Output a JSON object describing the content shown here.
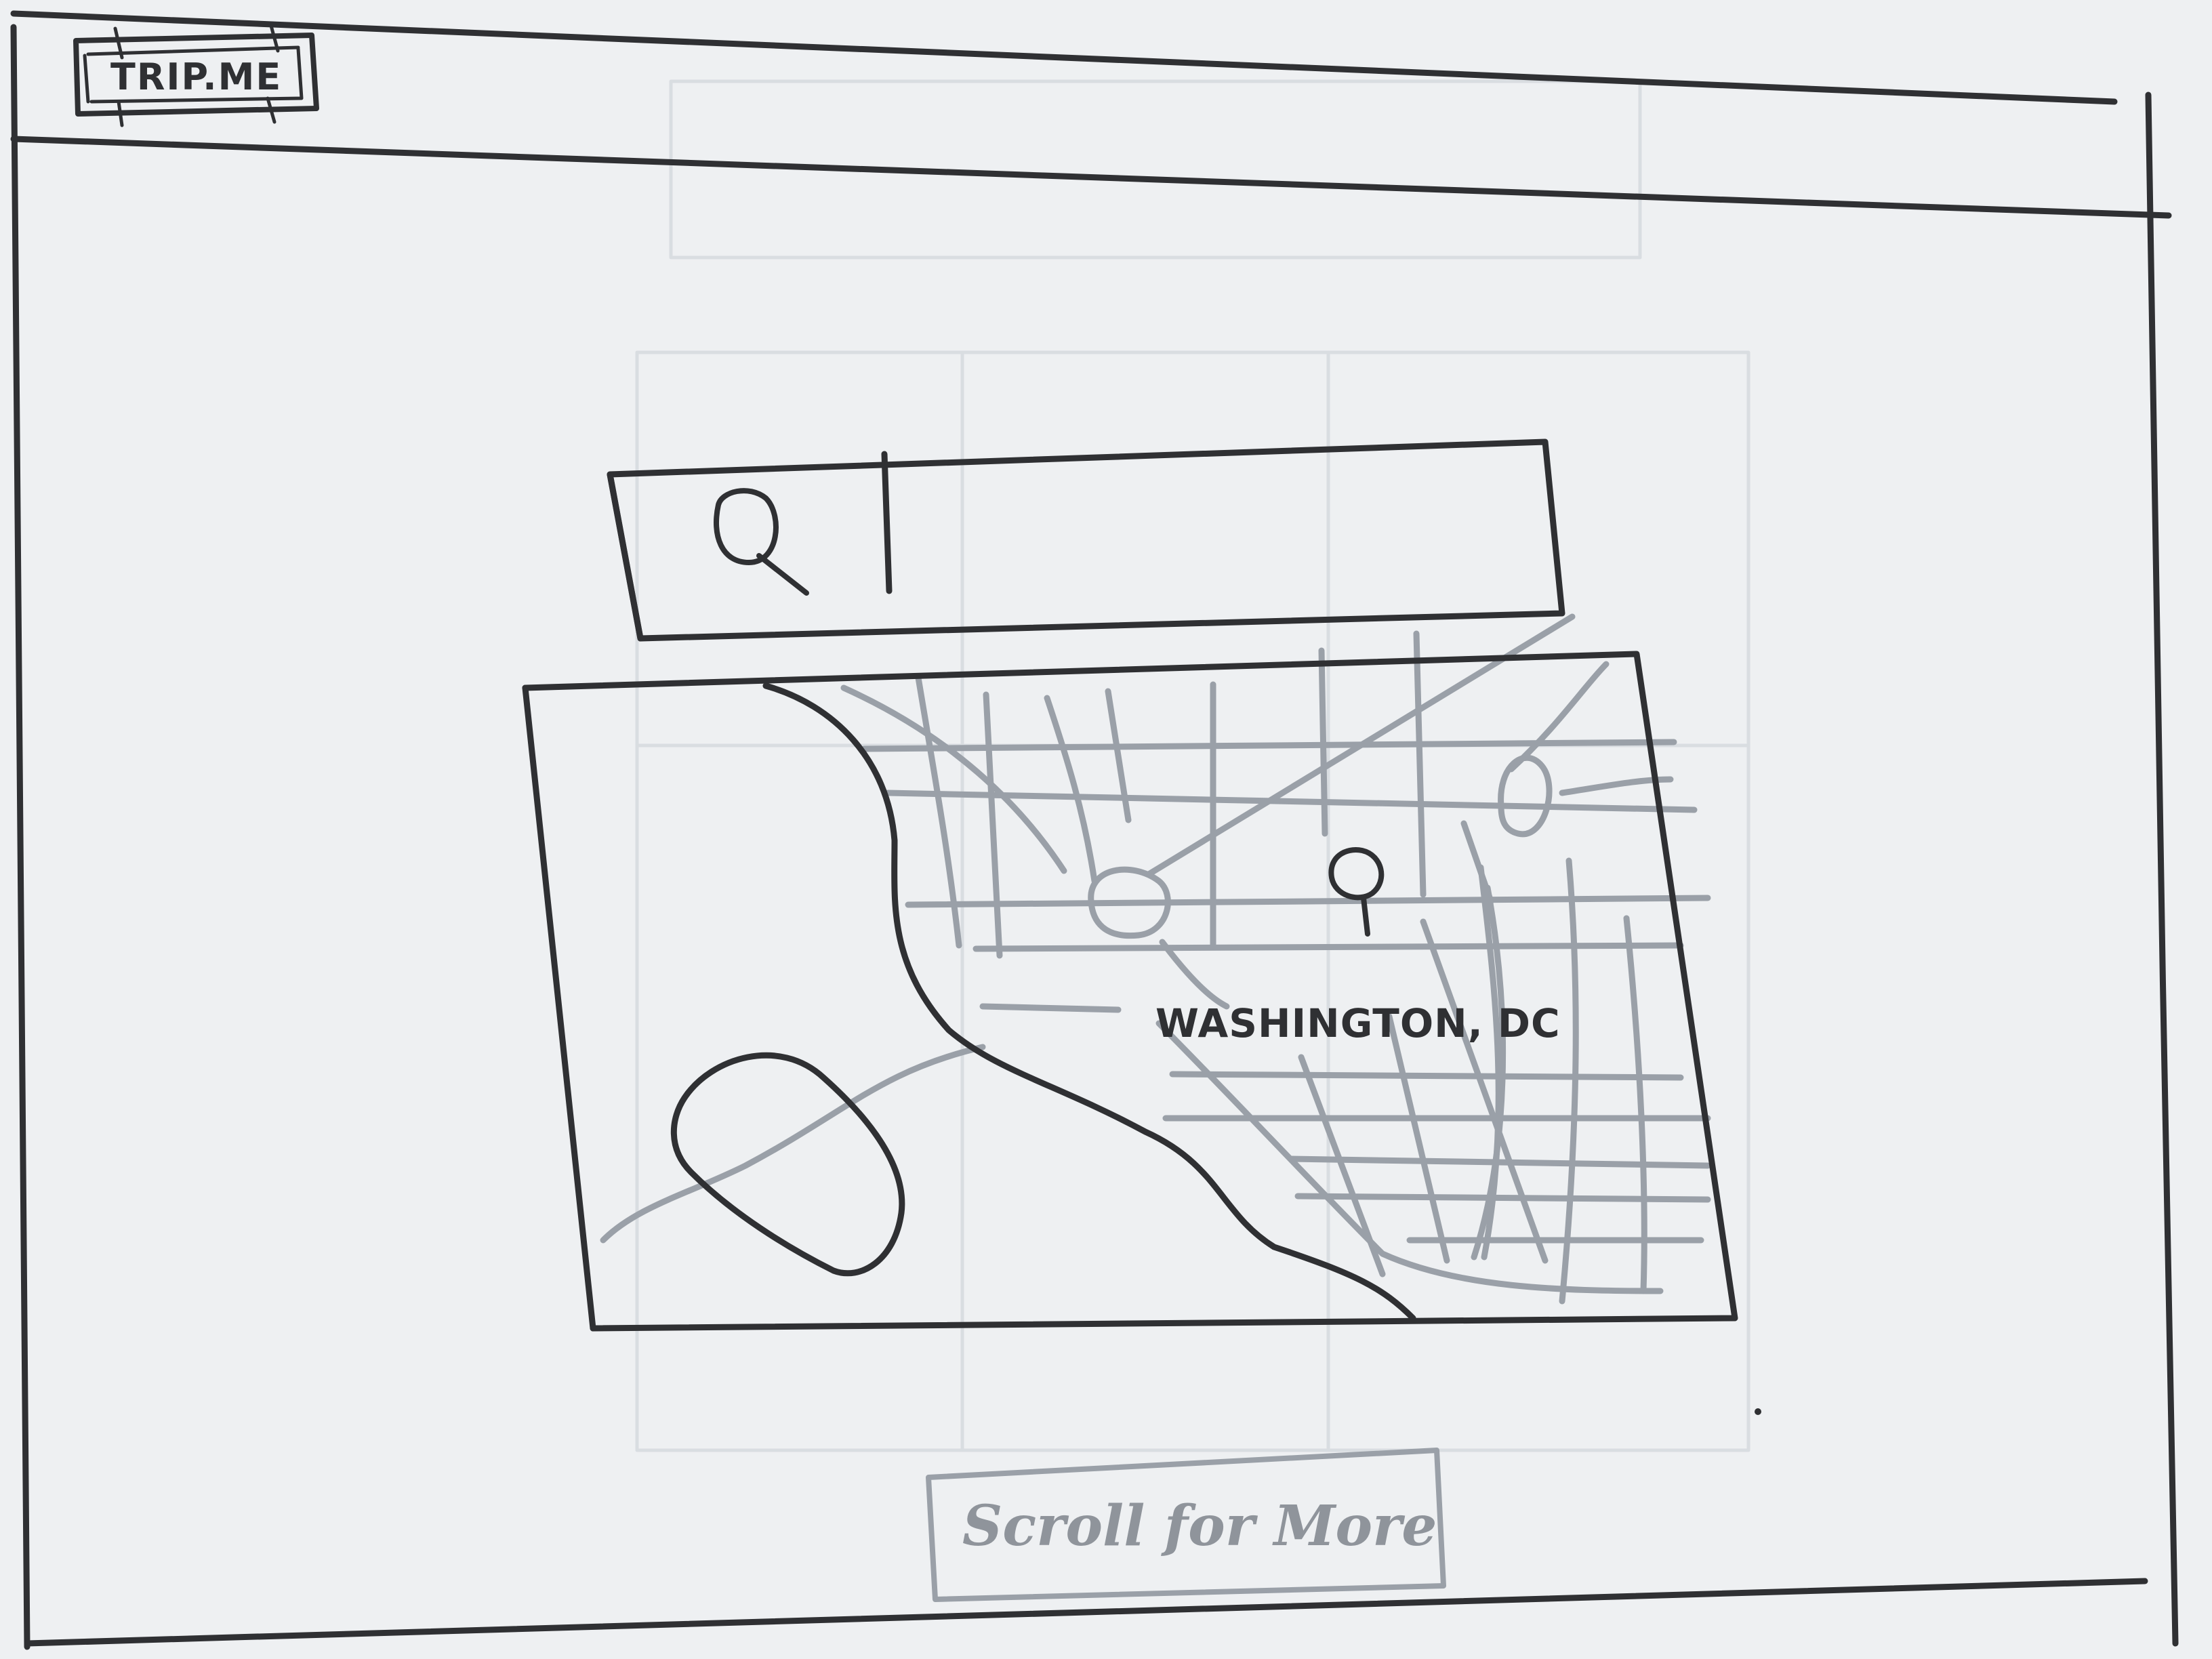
{
  "header": {
    "logo_text": "TRIP.ME"
  },
  "search": {
    "icon": "search-icon",
    "value": ""
  },
  "map": {
    "location_label": "WASHINGTON, DC",
    "marker_icon": "map-pin-icon"
  },
  "footer": {
    "scroll_label": "Scroll for More"
  },
  "colors": {
    "ink": "#2f3033",
    "pencil": "#9aa0a8",
    "paper": "#eef0f2"
  }
}
